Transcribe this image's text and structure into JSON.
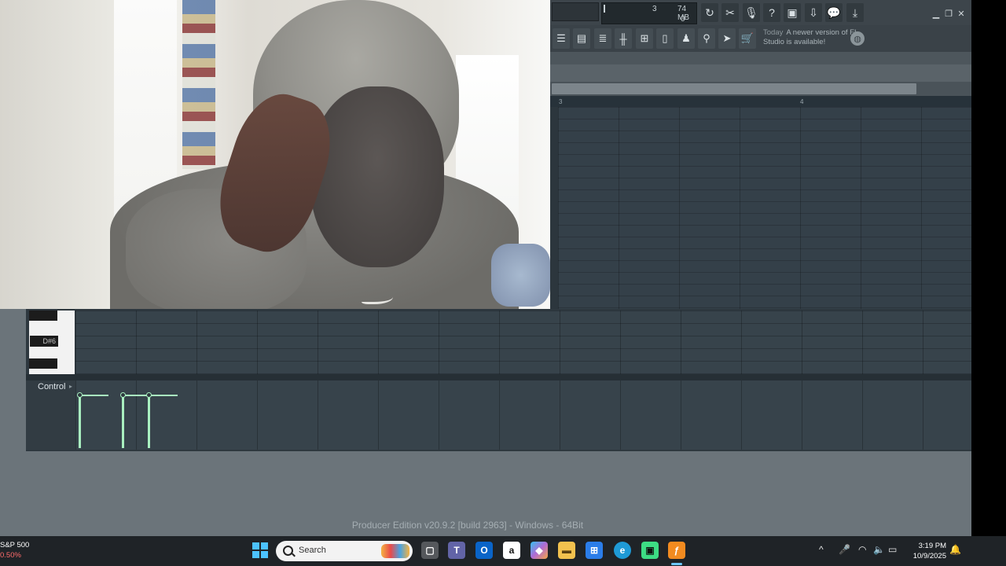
{
  "transport": {
    "pattern_value": "3",
    "memory": "74 MB",
    "cpu_value": "0"
  },
  "toolbar": {
    "icons": [
      "undo-icon",
      "cut-icon",
      "microphone-icon",
      "help-icon",
      "save-icon",
      "export-icon",
      "chat-icon",
      "download-icon"
    ],
    "window_icons": [
      "minimize-icon",
      "restore-icon",
      "close-icon"
    ],
    "view_icons": [
      "browser-icon",
      "channel-rack-icon",
      "mixer-icon",
      "piano-roll-icon",
      "plugin-picker-icon",
      "project-icon",
      "playlist-icon",
      "tempo-icon",
      "pointer-icon",
      "store-icon"
    ]
  },
  "news": {
    "today": "Today",
    "message": "A newer version of FL Studio is available!"
  },
  "playlist": {
    "ruler_marks": [
      "3",
      "4"
    ]
  },
  "piano_roll": {
    "key_label": "D#6",
    "control_label": "Control",
    "velocity_notes": [
      1.0,
      1.0,
      1.0
    ]
  },
  "edition_text": "Producer Edition v20.9.2 [build 2963] - Windows - 64Bit",
  "taskbar": {
    "stock_name": "S&P 500",
    "stock_change": "0.50%",
    "search_placeholder": "Search",
    "apps": [
      "task-view-icon",
      "teams-icon",
      "outlook-icon",
      "amazon-icon",
      "copilot-icon",
      "file-explorer-icon",
      "store-icon",
      "edge-icon",
      "mobile-app-icon",
      "fl-studio-icon"
    ],
    "time": "3:19 PM",
    "date": "10/9/2025"
  }
}
